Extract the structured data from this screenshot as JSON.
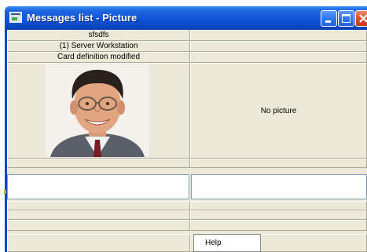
{
  "window": {
    "title": "Messages list - Picture"
  },
  "grid": {
    "left_rows": [
      "sfsdfs",
      "(1)  Server Workstation",
      "Card definition modified"
    ],
    "right_picture_text": "No picture"
  },
  "context_menu": {
    "items": [
      "Help"
    ]
  },
  "icons": {
    "app": "app-window-icon",
    "minimize": "minimize-icon",
    "maximize": "maximize-icon",
    "close": "close-icon",
    "photo": "person-photo"
  },
  "colors": {
    "titlebar": "#0b48c4",
    "close_button": "#d8482a",
    "window_face": "#ece9d8"
  }
}
